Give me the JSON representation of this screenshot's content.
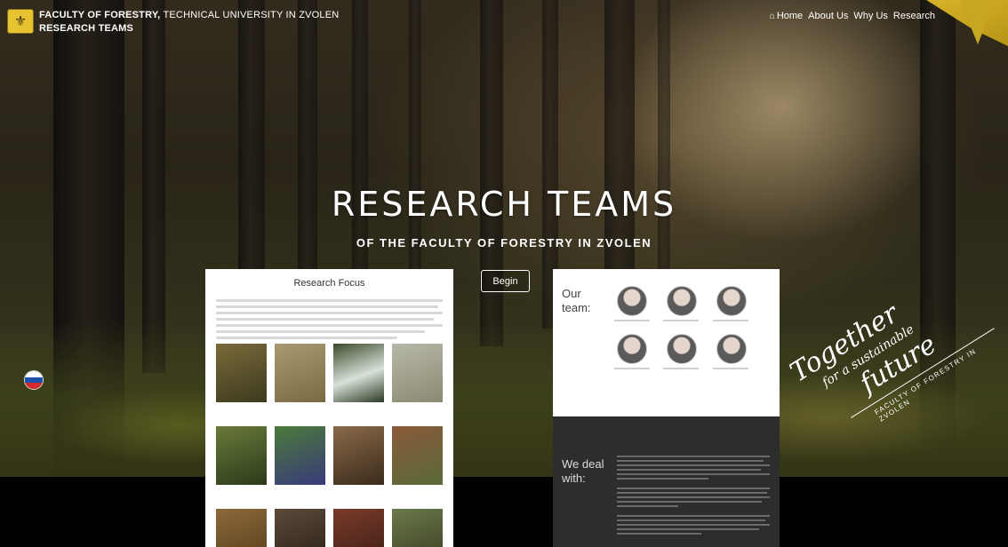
{
  "header": {
    "brand_line1_bold": "FACULTY OF FORESTRY,",
    "brand_line1_rest": " TECHNICAL UNIVERSITY IN ZVOLEN",
    "brand_line2": "RESEARCH TEAMS",
    "logo_icon": "university-seal-icon",
    "nav": [
      {
        "label": "Home",
        "icon": "home-icon"
      },
      {
        "label": "About Us"
      },
      {
        "label": "Why Us"
      },
      {
        "label": "Research"
      }
    ]
  },
  "hero": {
    "title": "RESEARCH TEAMS",
    "subtitle": "OF THE FACULTY OF FORESTRY IN ZVOLEN",
    "begin_label": "Begin",
    "language_flag": "slovak-flag-icon"
  },
  "tagline": {
    "line1": "Together",
    "line2": "for a sustainable",
    "line3": "future",
    "line4": "FACULTY OF FORESTRY IN ZVOLEN"
  },
  "focus_card": {
    "title": "Research Focus"
  },
  "team_card": {
    "heading_line1": "Our",
    "heading_line2": "team:",
    "deal_line1": "We deal",
    "deal_line2": "with:"
  },
  "colors": {
    "accent_gold": "#d8b528",
    "card_dark": "#2d2d2d",
    "flag_white": "#ffffff",
    "flag_blue": "#1b4fb0",
    "flag_red": "#d22b2b"
  }
}
